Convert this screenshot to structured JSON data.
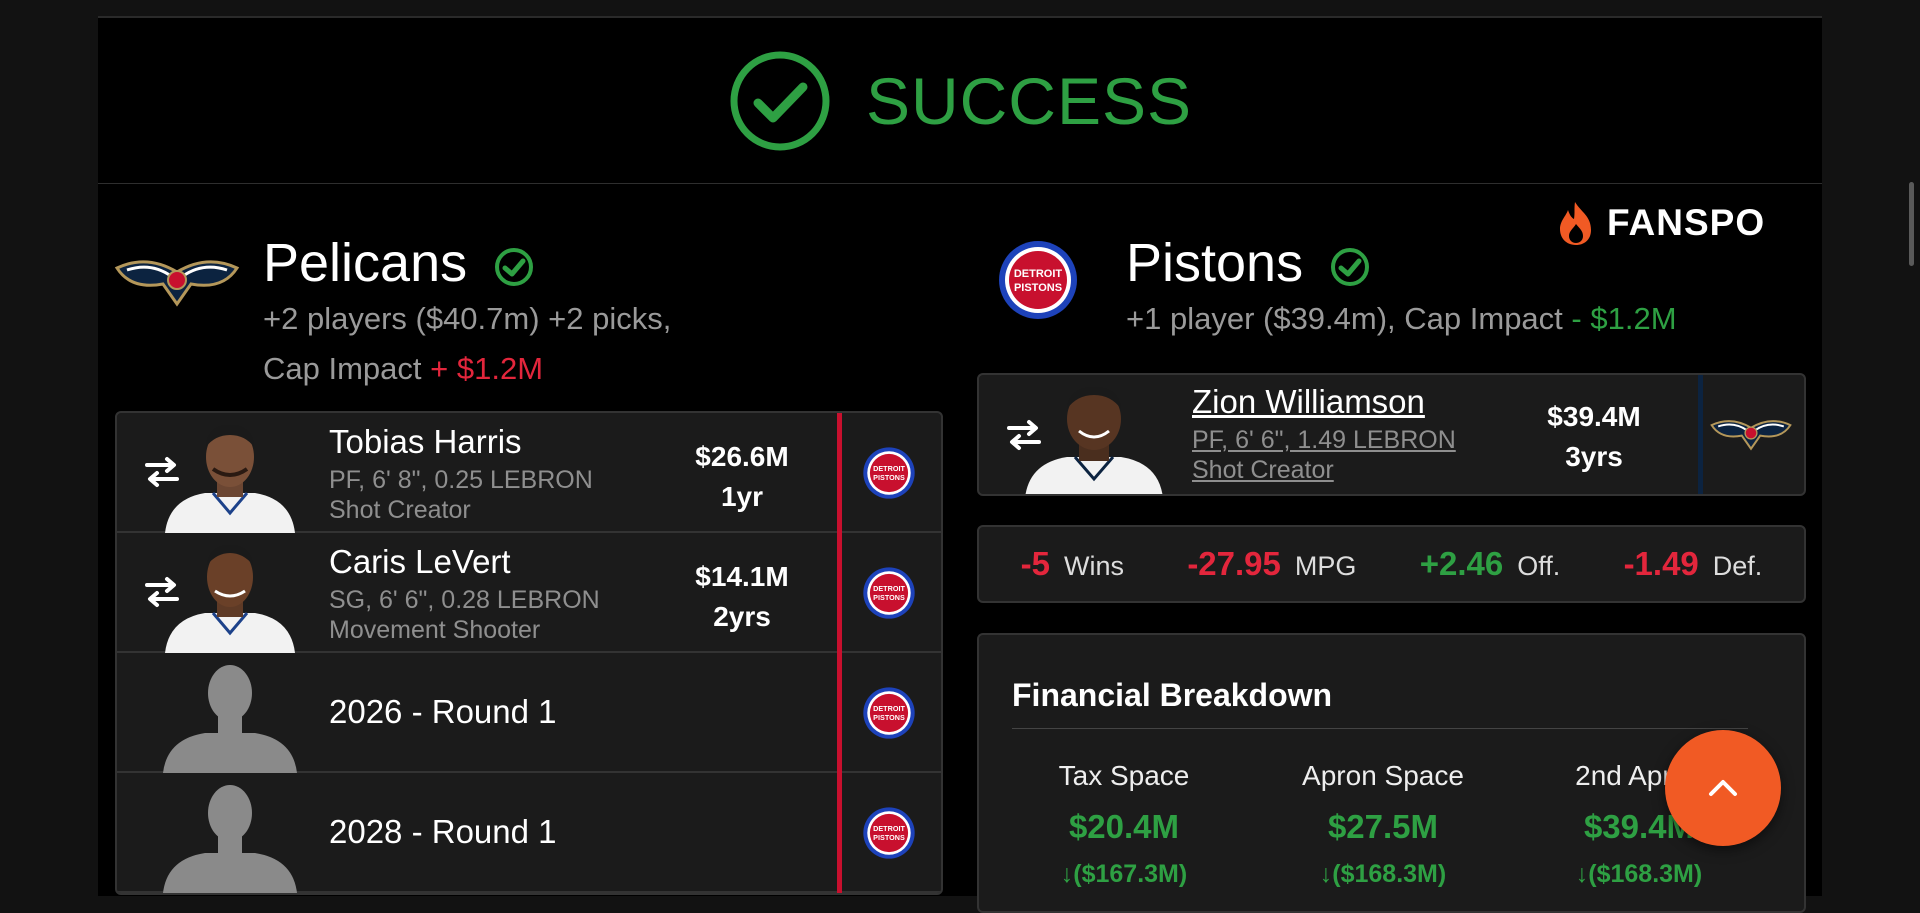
{
  "banner": {
    "status": "SUCCESS",
    "color": "#2ea043"
  },
  "brand": {
    "name": "FANSPO"
  },
  "team_left": {
    "name": "Pelicans",
    "summary_line1": "+2 players ($40.7m) +2 picks,",
    "cap_label": "Cap Impact",
    "cap_value": "+ $1.2M",
    "assets": [
      {
        "type": "player",
        "name": "Tobias Harris",
        "meta1": "PF, 6' 8\", 0.25 LEBRON",
        "meta2": "Shot Creator",
        "salary": "$26.6M",
        "years": "1yr"
      },
      {
        "type": "player",
        "name": "Caris LeVert",
        "meta1": "SG, 6' 6\", 0.28 LEBRON",
        "meta2": "Movement Shooter",
        "salary": "$14.1M",
        "years": "2yrs"
      },
      {
        "type": "pick",
        "label": "2026 - Round 1"
      },
      {
        "type": "pick",
        "label": "2028 - Round 1"
      }
    ]
  },
  "team_right": {
    "name": "Pistons",
    "summary": "+1 player ($39.4m), Cap Impact",
    "cap_value": "- $1.2M",
    "asset": {
      "name": "Zion Williamson",
      "meta1": "PF, 6' 6\", 1.49 LEBRON",
      "meta2": "Shot Creator",
      "salary": "$39.4M",
      "years": "3yrs"
    },
    "impact": [
      {
        "value": "-5",
        "label": "Wins",
        "color": "#e3263c"
      },
      {
        "value": "-27.95",
        "label": "MPG",
        "color": "#e3263c"
      },
      {
        "value": "+2.46",
        "label": "Off.",
        "color": "#2ea043"
      },
      {
        "value": "-1.49",
        "label": "Def.",
        "color": "#e3263c"
      }
    ],
    "financial": {
      "title": "Financial Breakdown",
      "columns": [
        {
          "label": "Tax Space",
          "value": "$20.4M",
          "delta": "($167.3M)"
        },
        {
          "label": "Apron Space",
          "value": "$27.5M",
          "delta": "($168.3M)"
        },
        {
          "label": "2nd Apron",
          "value": "$39.4M",
          "delta": "($168.3M)"
        }
      ]
    }
  },
  "icons": [
    "check-circle-icon",
    "swap-arrows-icon",
    "pelicans-logo",
    "pistons-logo",
    "fanspo-flame-icon",
    "chevron-up-icon",
    "arrow-down-icon"
  ]
}
